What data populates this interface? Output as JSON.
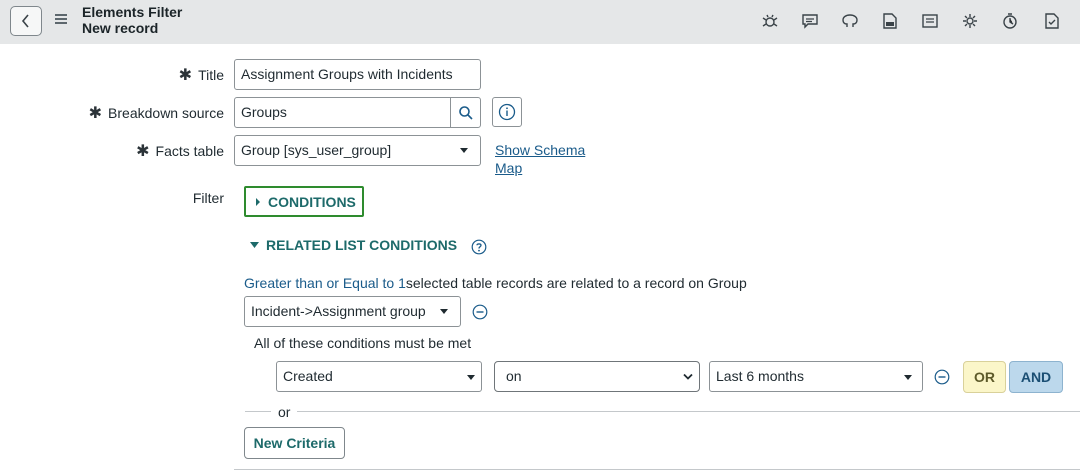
{
  "header": {
    "title": "Elements Filter",
    "subtitle": "New record"
  },
  "form": {
    "title_label": "Title",
    "title_value": "Assignment Groups with Incidents",
    "breakdown_label": "Breakdown source",
    "breakdown_value": "Groups",
    "facts_label": "Facts table",
    "facts_value": "Group [sys_user_group]",
    "schema_link_line1": "Show Schema",
    "schema_link_line2": "Map",
    "filter_label": "Filter",
    "required_mark": "✱"
  },
  "conditions": {
    "conditions_label": "CONDITIONS",
    "related_label": "RELATED LIST CONDITIONS",
    "quantity_link": "Greater than or Equal to 1",
    "related_text": "selected table records are related to a record on Group",
    "relationship_value": "Incident->Assignment group",
    "all_met_text": "All of these conditions must be met",
    "field_value": "Created",
    "operator_value": "on",
    "value_value": "Last 6 months",
    "or_button": "OR",
    "and_button": "AND",
    "or_divider": "or",
    "new_criteria_button": "New Criteria"
  },
  "icons": [
    "back-icon",
    "menu-icon",
    "bug-icon",
    "chat-icon",
    "github-icon",
    "download-icon",
    "list-icon",
    "gear-icon",
    "clock-icon",
    "document-icon",
    "search-icon",
    "info-icon",
    "triangle-right-icon",
    "triangle-down-icon",
    "help-icon",
    "minus-circle-icon"
  ]
}
